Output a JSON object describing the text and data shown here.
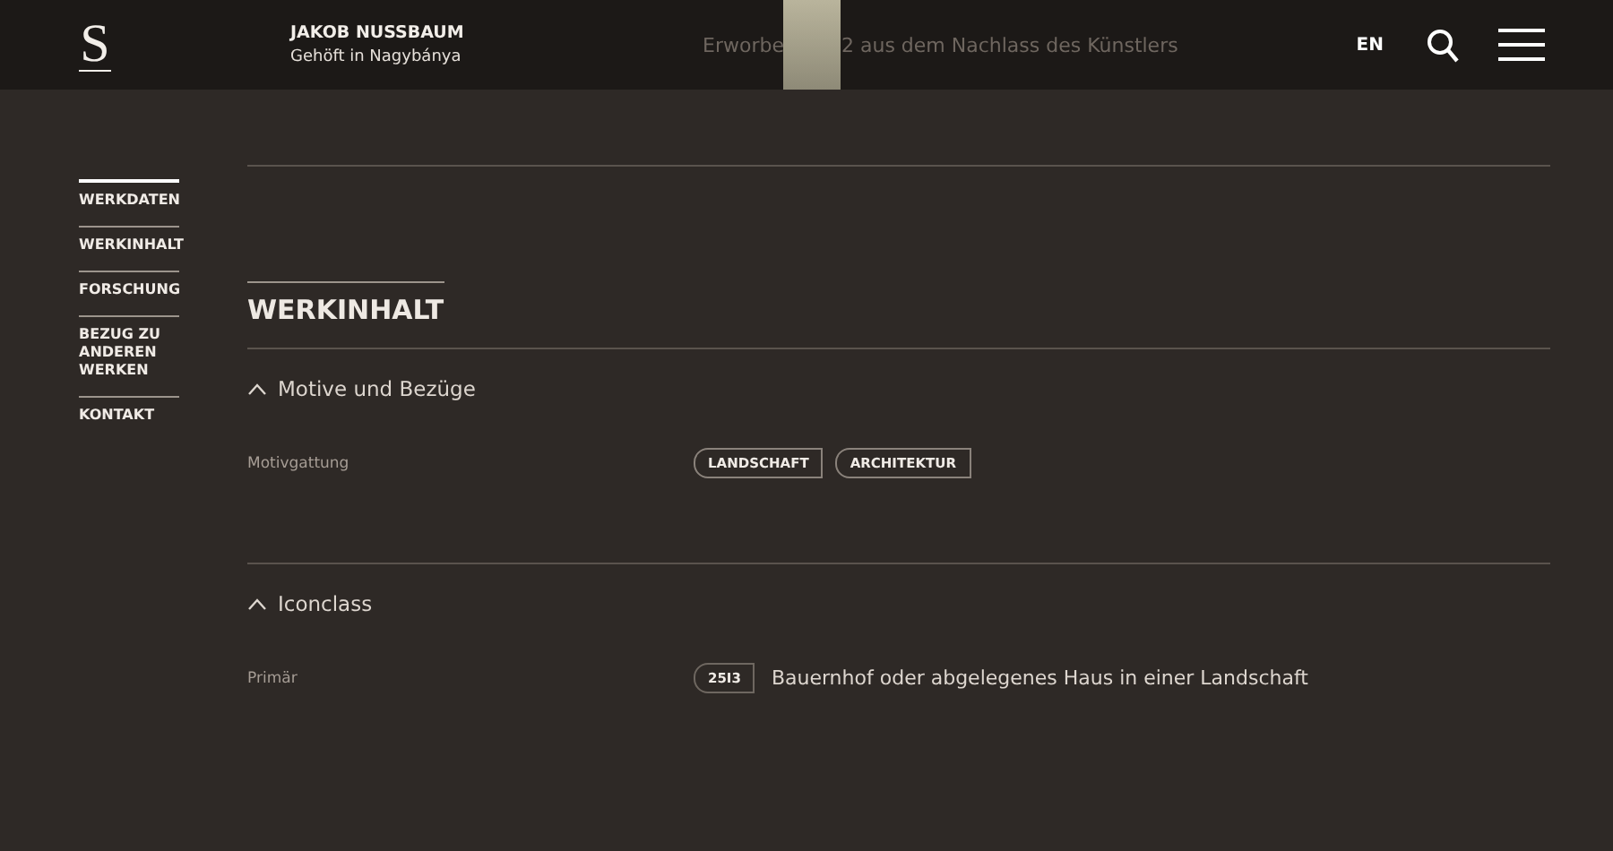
{
  "header": {
    "logo": "S",
    "artist": "JAKOB NUSSBAUM",
    "title": "Gehöft in Nagybánya",
    "behind_text_start": "Erworbe",
    "behind_text_end": "2 aus dem Nachlass des Künstlers",
    "language": "EN"
  },
  "sidebar": {
    "items": [
      {
        "label": "WERKDATEN",
        "selected": true
      },
      {
        "label": "WERKINHALT",
        "selected": false
      },
      {
        "label": "FORSCHUNG",
        "selected": false
      },
      {
        "label": "BEZUG ZU ANDEREN WERKEN",
        "selected": false
      },
      {
        "label": "KONTAKT",
        "selected": false
      }
    ]
  },
  "section": {
    "title": "WERKINHALT",
    "groups": [
      {
        "title": "Motive und Bezüge",
        "expanded": true,
        "rows": [
          {
            "kind": "tags",
            "label": "Motivgattung",
            "tags": [
              "LANDSCHAFT",
              "ARCHITEKTUR"
            ]
          }
        ]
      },
      {
        "title": "Iconclass",
        "expanded": true,
        "rows": [
          {
            "kind": "code",
            "label": "Primär",
            "code": "25I3",
            "text": "Bauernhof oder abgelegenes Haus in einer Landschaft"
          }
        ]
      }
    ]
  }
}
